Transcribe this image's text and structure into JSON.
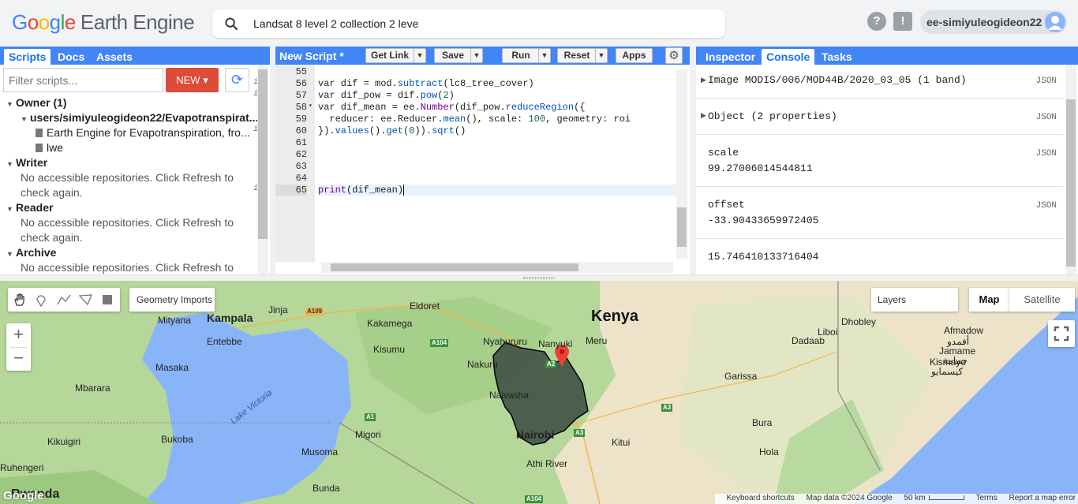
{
  "header": {
    "logo_google": "Google",
    "logo_product": "Earth Engine",
    "search_value": "Landsat 8 level 2 collection 2 leve",
    "help_icon": "?",
    "feedback_icon": "!",
    "account": "ee-simiyuleogideon22"
  },
  "left": {
    "tabs": [
      "Scripts",
      "Docs",
      "Assets"
    ],
    "filter_placeholder": "Filter scripts...",
    "new_label": "NEW",
    "tree": {
      "owner": "Owner (1)",
      "repo": "users/simiyuleogideon22/Evapotranspirat...",
      "file1": "Earth Engine for Evapotranspiration, fro...",
      "file2": "lwe",
      "writer": "Writer",
      "writer_msg1": "No accessible repositories. Click Refresh to",
      "writer_msg2": "check again.",
      "reader": "Reader",
      "reader_msg1": "No accessible repositories. Click Refresh to",
      "reader_msg2": "check again.",
      "archive": "Archive",
      "archive_msg1": "No accessible repositories. Click Refresh to"
    }
  },
  "editor": {
    "title": "New Script *",
    "buttons": {
      "getlink": "Get Link",
      "save": "Save",
      "run": "Run",
      "reset": "Reset",
      "apps": "Apps"
    },
    "line_numbers": [
      "55",
      "56",
      "57",
      "58",
      "59",
      "60",
      "61",
      "62",
      "63",
      "64",
      "65"
    ],
    "lines": {
      "l56a": "var dif = mod.",
      "l56b": "subtract",
      "l56c": "(lc8_tree_cover)",
      "l57a": "var dif_pow = dif.",
      "l57b": "pow",
      "l57c": "(",
      "l57d": "2",
      "l57e": ")",
      "l58a": "var dif_mean = ee.",
      "l58b": "Number",
      "l58c": "(dif_pow.",
      "l58d": "reduceRegion",
      "l58e": "({",
      "l59a": "  reducer: ee.Reducer.",
      "l59b": "mean",
      "l59c": "(), scale: ",
      "l59d": "100",
      "l59e": ", geometry: roi",
      "l60a": "}).",
      "l60b": "values",
      "l60c": "().",
      "l60d": "get",
      "l60e": "(",
      "l60f": "0",
      "l60g": ")).",
      "l60h": "sqrt",
      "l60i": "()",
      "l65a": "print",
      "l65b": "(dif_mean)"
    }
  },
  "console": {
    "tabs": [
      "Inspector",
      "Console",
      "Tasks"
    ],
    "entries": [
      {
        "text": "Image MODIS/006/MOD44B/2020_03_05 (1 band)",
        "json": "JSON"
      },
      {
        "text": "Object (2 properties)",
        "json": "JSON"
      },
      {
        "label": "scale",
        "value": "99.27006014544811",
        "json": "JSON"
      },
      {
        "label": "offset",
        "value": "-33.90433659972405",
        "json": "JSON"
      },
      {
        "value": "15.746410133716404"
      }
    ]
  },
  "map": {
    "geometry_imports": "Geometry Imports",
    "layers": "Layers",
    "map_type": "Map",
    "satellite": "Satellite",
    "zoom_in": "+",
    "zoom_out": "−",
    "labels": {
      "kenya": "Kenya",
      "kampala": "Kampala",
      "entebbe": "Entebbe",
      "mityana": "Mityana",
      "jinja": "Jinja",
      "eldoret": "Eldoret",
      "kakamega": "Kakamega",
      "kisumu": "Kisumu",
      "nyahururu": "Nyahururu",
      "nanyuki": "Nanyuki",
      "meru": "Meru",
      "nakuru": "Nakuru",
      "naivasha": "Naivasha",
      "nairobi": "Nairobi",
      "kitui": "Kitui",
      "athi": "Athi River",
      "migori": "Migori",
      "musoma": "Musoma",
      "bunda": "Bunda",
      "masaka": "Masaka",
      "mbarara": "Mbarara",
      "bukoba": "Bukoba",
      "kikuigiri": "Kikuigiri",
      "ruhengeri": "Ruhengeri",
      "rwanda": "Rwanda",
      "victoria": "Lake Victoria",
      "garissa": "Garissa",
      "bura": "Bura",
      "hola": "Hola",
      "dadaab": "Dadaab",
      "liboi": "Liboi",
      "dhobley": "Dhobley",
      "afmadow": "Afmadow",
      "afmadow_ar": "أفمدو",
      "jamame": "Jamame",
      "jamame_ar": "جمامة",
      "kismayo": "Kismayo",
      "kismayo_ar": "كيسمايو",
      "google": "Google"
    },
    "roads": {
      "a109": "A109",
      "a104": "A104",
      "a104b": "A104",
      "a1": "A1",
      "a3": "A3",
      "a3b": "A3",
      "a2": "A2"
    },
    "attribution": {
      "shortcuts": "Keyboard shortcuts",
      "data": "Map data ©2024 Google",
      "scale": "50 km",
      "terms": "Terms",
      "report": "Report a map error"
    }
  }
}
